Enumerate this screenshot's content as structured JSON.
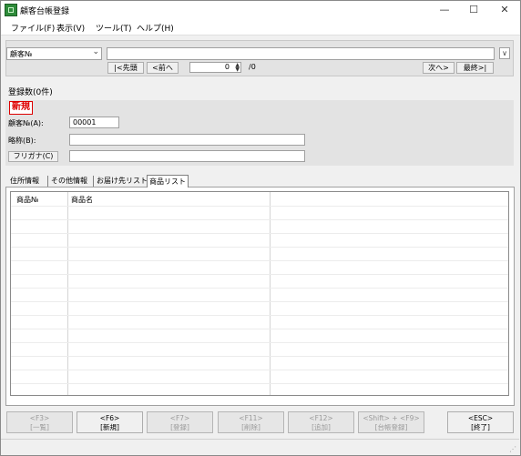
{
  "window": {
    "title": "顧客台帳登録",
    "minimize": "—",
    "maximize": "☐",
    "close": "✕"
  },
  "menu": [
    "ファイル(F)",
    "表示(V)",
    "ツール(T)",
    "ヘルプ(H)"
  ],
  "toolbar": {
    "search_field_select": "顧客№",
    "search_text": "",
    "expand_btn": "∨",
    "first_btn": "|<先頭",
    "prev_btn": "<前へ",
    "record_index": "0",
    "record_total": "/0",
    "next_btn": "次へ>",
    "last_btn": "最終>|"
  },
  "record_count": "登録数(0件)",
  "form": {
    "mode_badge": "新規",
    "customer_no_label": "顧客№(A):",
    "customer_no_value": "00001",
    "short_name_label": "略称(B):",
    "short_name_value": "",
    "furigana_btn": "フリガナ(C)",
    "furigana_value": ""
  },
  "tabs": [
    "住所情報",
    "その他情報",
    "お届け先リスト",
    "商品リスト"
  ],
  "active_tab": 3,
  "grid": {
    "columns": [
      "商品№",
      "商品名"
    ],
    "rows": []
  },
  "fkeys": [
    {
      "key": "<F3>",
      "label": "[一覧]",
      "enabled": false
    },
    {
      "key": "<F6>",
      "label": "[新規]",
      "enabled": true
    },
    {
      "key": "<F7>",
      "label": "[登録]",
      "enabled": false
    },
    {
      "key": "<F11>",
      "label": "[削除]",
      "enabled": false
    },
    {
      "key": "<F12>",
      "label": "[追加]",
      "enabled": false
    },
    {
      "key": "<Shift> + <F9>",
      "label": "[台帳登録]",
      "enabled": false
    },
    {
      "key": "<ESC>",
      "label": "[終了]",
      "enabled": true
    }
  ]
}
